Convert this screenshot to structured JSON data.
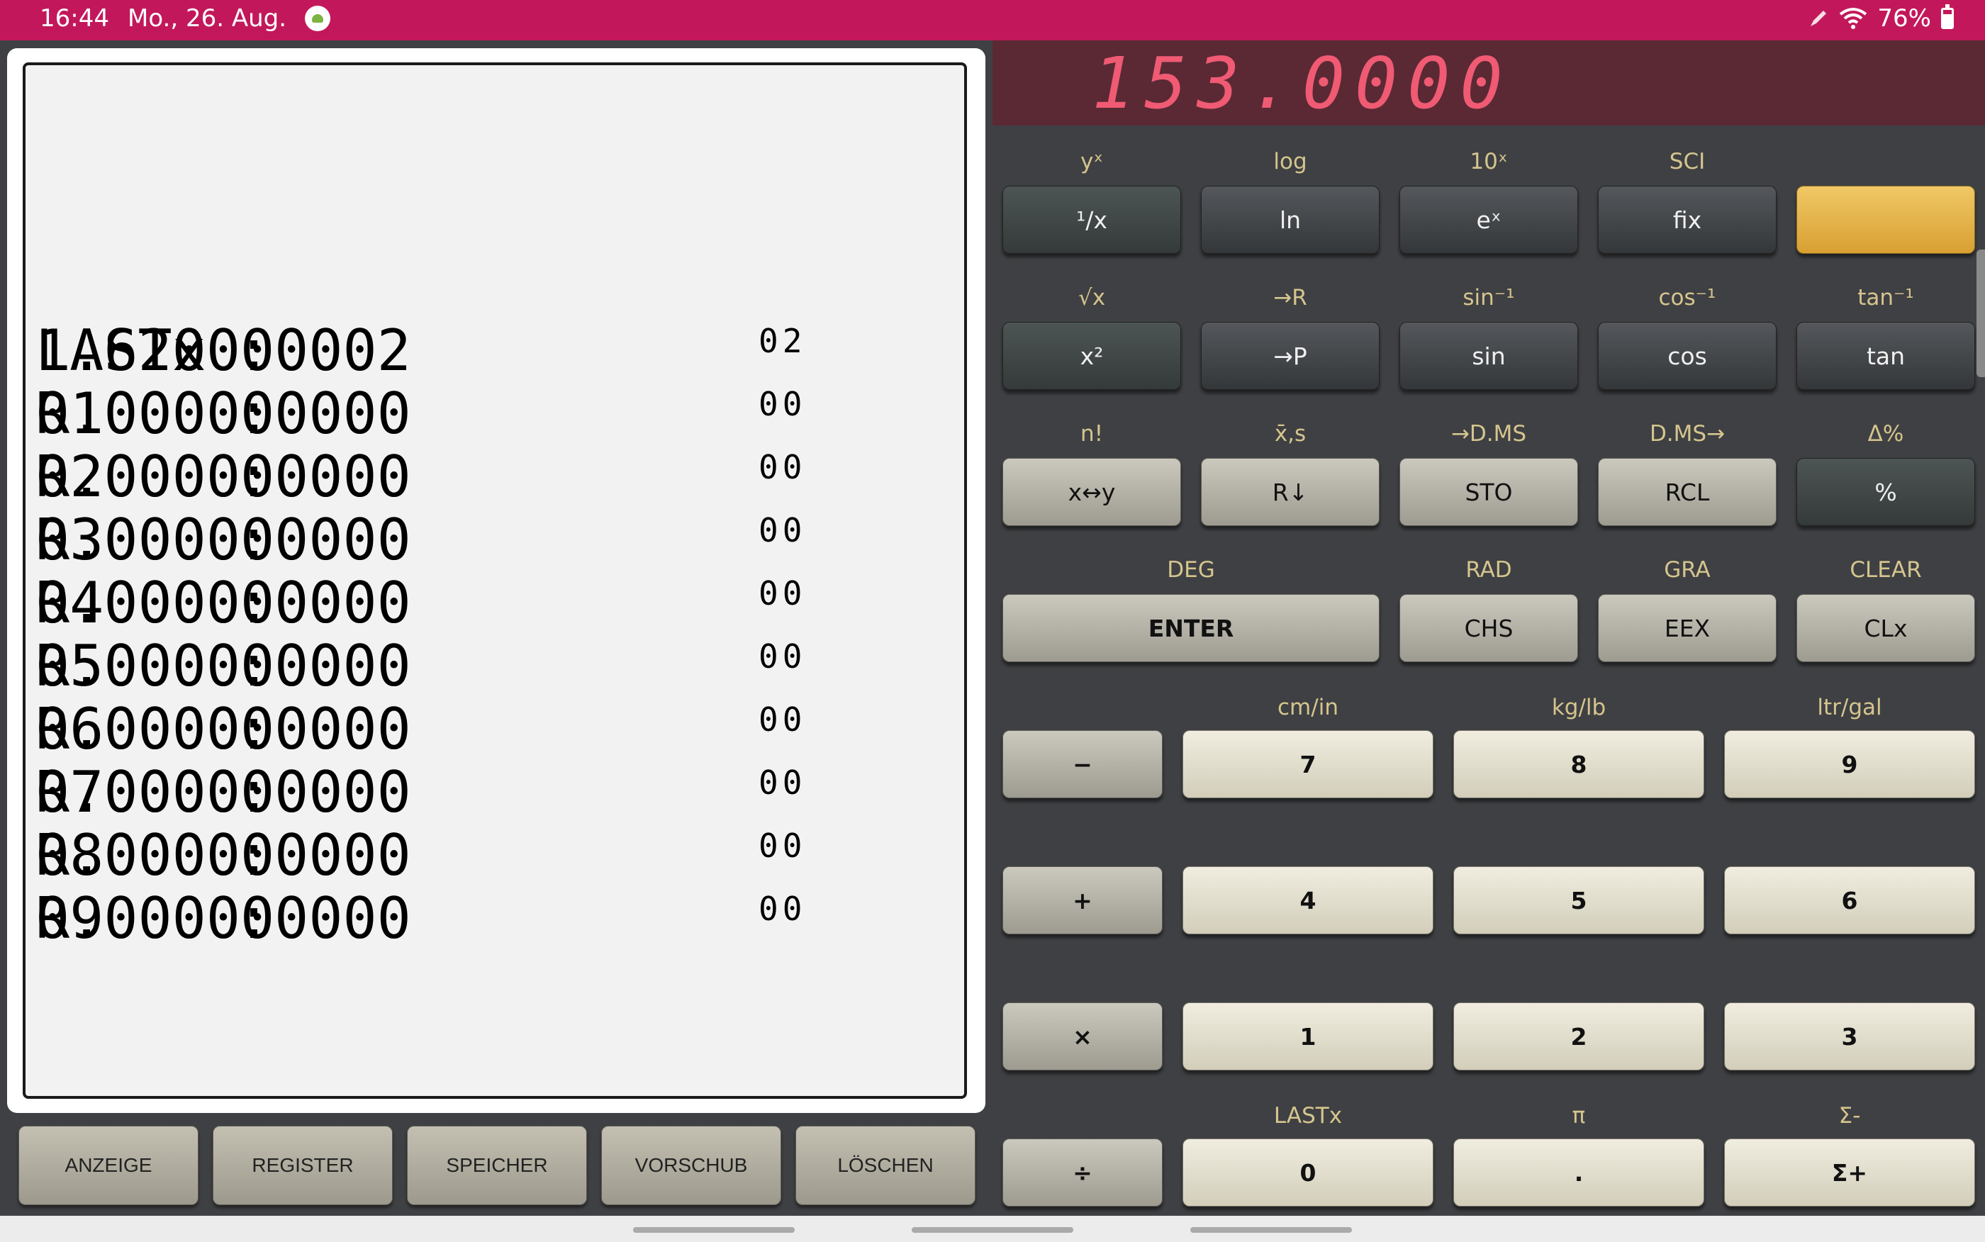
{
  "status_bar": {
    "time": "16:44",
    "date": "Mo., 26. Aug.",
    "battery": "76%",
    "icons": [
      "android-notification-icon",
      "pen-icon",
      "wifi-icon",
      "battery-icon"
    ]
  },
  "lcd": {
    "value": "153.0000"
  },
  "printout": {
    "rows": [
      {
        "name": "LASTx",
        "colon": ":",
        "value": "1.620000002",
        "exp": "02"
      },
      {
        "name": "R1",
        "colon": ":",
        "value": "0.000000000",
        "exp": "00"
      },
      {
        "name": "R2",
        "colon": ":",
        "value": "0.000000000",
        "exp": "00"
      },
      {
        "name": "R3",
        "colon": ":",
        "value": "0.000000000",
        "exp": "00"
      },
      {
        "name": "R4",
        "colon": ":",
        "value": "0.000000000",
        "exp": "00"
      },
      {
        "name": "R5",
        "colon": ":",
        "value": "0.000000000",
        "exp": "00"
      },
      {
        "name": "R6",
        "colon": ":",
        "value": "0.000000000",
        "exp": "00"
      },
      {
        "name": "R7",
        "colon": ":",
        "value": "0.000000000",
        "exp": "00"
      },
      {
        "name": "R8",
        "colon": ":",
        "value": "0.000000000",
        "exp": "00"
      },
      {
        "name": "R9",
        "colon": ":",
        "value": "0.000000000",
        "exp": "00"
      }
    ]
  },
  "printer_buttons": [
    "ANZEIGE",
    "REGISTER",
    "SPEICHER",
    "VORSCHUB",
    "LÖSCHEN"
  ],
  "rows5": {
    "r1": {
      "labels": [
        "yˣ",
        "log",
        "10ˣ",
        "SCI",
        ""
      ],
      "keys": [
        "¹/x",
        "ln",
        "eˣ",
        "fix",
        ""
      ]
    },
    "r2": {
      "labels": [
        "√x",
        "→R",
        "sin⁻¹",
        "cos⁻¹",
        "tan⁻¹"
      ],
      "keys": [
        "x²",
        "→P",
        "sin",
        "cos",
        "tan"
      ]
    },
    "r3": {
      "labels": [
        "n!",
        "x̄,s",
        "→D.MS",
        "D.MS→",
        "Δ%"
      ],
      "keys": [
        "x↔y",
        "R↓",
        "STO",
        "RCL",
        "%"
      ]
    },
    "r4": {
      "labels": [
        "DEG",
        "RAD",
        "GRA",
        "CLEAR"
      ],
      "keys": [
        "ENTER",
        "CHS",
        "EEX",
        "CLx"
      ]
    }
  },
  "numpad": {
    "label_row1": [
      "cm/in",
      "kg/lb",
      "ltr/gal"
    ],
    "label_row4": [
      "LASTx",
      "π",
      "Σ-"
    ],
    "ops": [
      "−",
      "+",
      "×",
      "÷"
    ],
    "r1": [
      "7",
      "8",
      "9"
    ],
    "r2": [
      "4",
      "5",
      "6"
    ],
    "r3": [
      "1",
      "2",
      "3"
    ],
    "r4": [
      "0",
      ".",
      "Σ+"
    ]
  },
  "colors": {
    "status_bar": "#c2185b",
    "lcd_bg": "#5a2934",
    "lcd_digits": "#f05a73",
    "function_label": "#d5c58e",
    "gold_key": "#e6b44a"
  }
}
